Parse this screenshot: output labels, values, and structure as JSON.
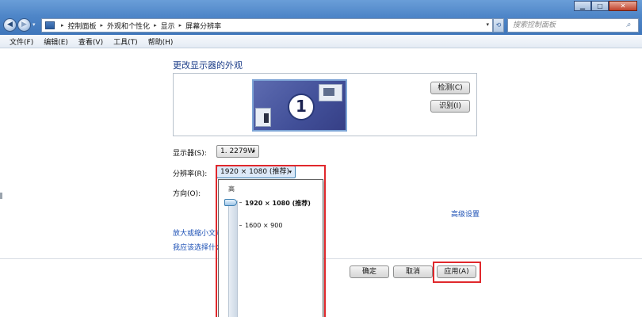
{
  "window": {
    "minimize_label": "▁",
    "maximize_label": "□",
    "close_label": "✕"
  },
  "nav": {
    "back_glyph": "◀",
    "forward_glyph": "▶",
    "dropdown_glyph": "▾"
  },
  "breadcrumb": {
    "items": [
      "控制面板",
      "外观和个性化",
      "显示",
      "屏幕分辨率"
    ],
    "separator": "▸",
    "dropdown_glyph": "▾"
  },
  "refresh": {
    "glyph": "⟲"
  },
  "search": {
    "placeholder": "搜索控制面板",
    "icon": "search-icon"
  },
  "menu": {
    "items": [
      "文件(F)",
      "编辑(E)",
      "查看(V)",
      "工具(T)",
      "帮助(H)"
    ]
  },
  "main": {
    "heading": "更改显示器的外观",
    "monitor_number": "1",
    "detect_label": "检测(C)",
    "identify_label": "识别(I)",
    "display_label": "显示器(S):",
    "display_value": "1. 2279W",
    "resolution_label": "分辨率(R):",
    "resolution_value": "1920 × 1080 (推荐)",
    "orientation_label": "方向(O):",
    "advanced_link": "高级设置",
    "textsize_link": "放大或缩小文本",
    "choose_link": "我应该选择什么",
    "combo_arrow": "▾"
  },
  "dropdown": {
    "high_label": "高",
    "options": [
      "1920 × 1080 (推荐)",
      "1600 × 900"
    ]
  },
  "footer": {
    "ok_label": "确定",
    "cancel_label": "取消",
    "apply_label": "应用(A)"
  },
  "colors": {
    "highlight": "#e0282c",
    "link": "#1c50b5",
    "heading": "#1e3f8a"
  }
}
